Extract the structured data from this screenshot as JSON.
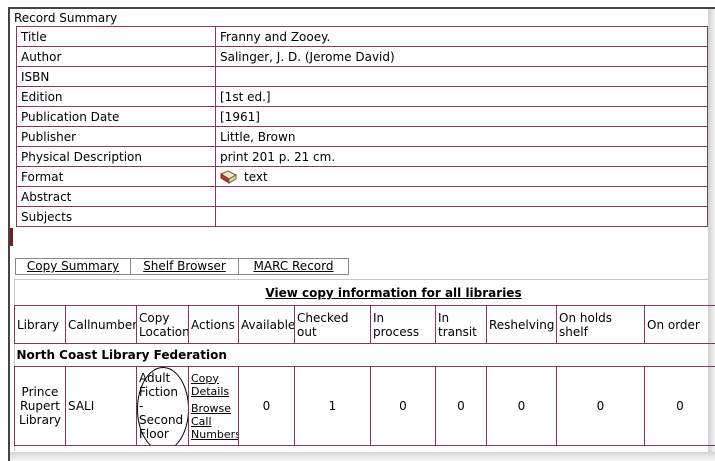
{
  "summary_title": "Record Summary",
  "record": [
    {
      "label": "Title",
      "value": "Franny and Zooey."
    },
    {
      "label": "Author",
      "value": "Salinger, J. D. (Jerome David)"
    },
    {
      "label": "ISBN",
      "value": ""
    },
    {
      "label": "Edition",
      "value": "[1st ed.]"
    },
    {
      "label": "Publication Date",
      "value": "[1961]"
    },
    {
      "label": "Publisher",
      "value": "Little, Brown"
    },
    {
      "label": "Physical Description",
      "value": "print 201 p. 21 cm."
    },
    {
      "label": "Format",
      "value": "text",
      "icon": "book-icon"
    },
    {
      "label": "Abstract",
      "value": ""
    },
    {
      "label": "Subjects",
      "value": ""
    }
  ],
  "tabs": [
    "Copy Summary",
    "Shelf Browser",
    "MARC Record"
  ],
  "view_all_link": "View copy information for all libraries",
  "copy_table": {
    "headers": [
      "Library",
      "Callnumber",
      "Copy Location",
      "Actions",
      "Available",
      "Checked out",
      "In process",
      "In transit",
      "Reshelving",
      "On holds shelf",
      "On order"
    ],
    "group": "North Coast Library Federation",
    "row": {
      "library": "Prince Rupert Library",
      "callnumber": "SALI",
      "copy_location": "Adult Fiction - Second Floor",
      "actions": [
        "Copy Details",
        "Browse Call Numbers"
      ],
      "available": "0",
      "checked_out": "1",
      "in_process": "0",
      "in_transit": "0",
      "reshelving": "0",
      "on_holds_shelf": "0",
      "on_order": "0"
    }
  }
}
